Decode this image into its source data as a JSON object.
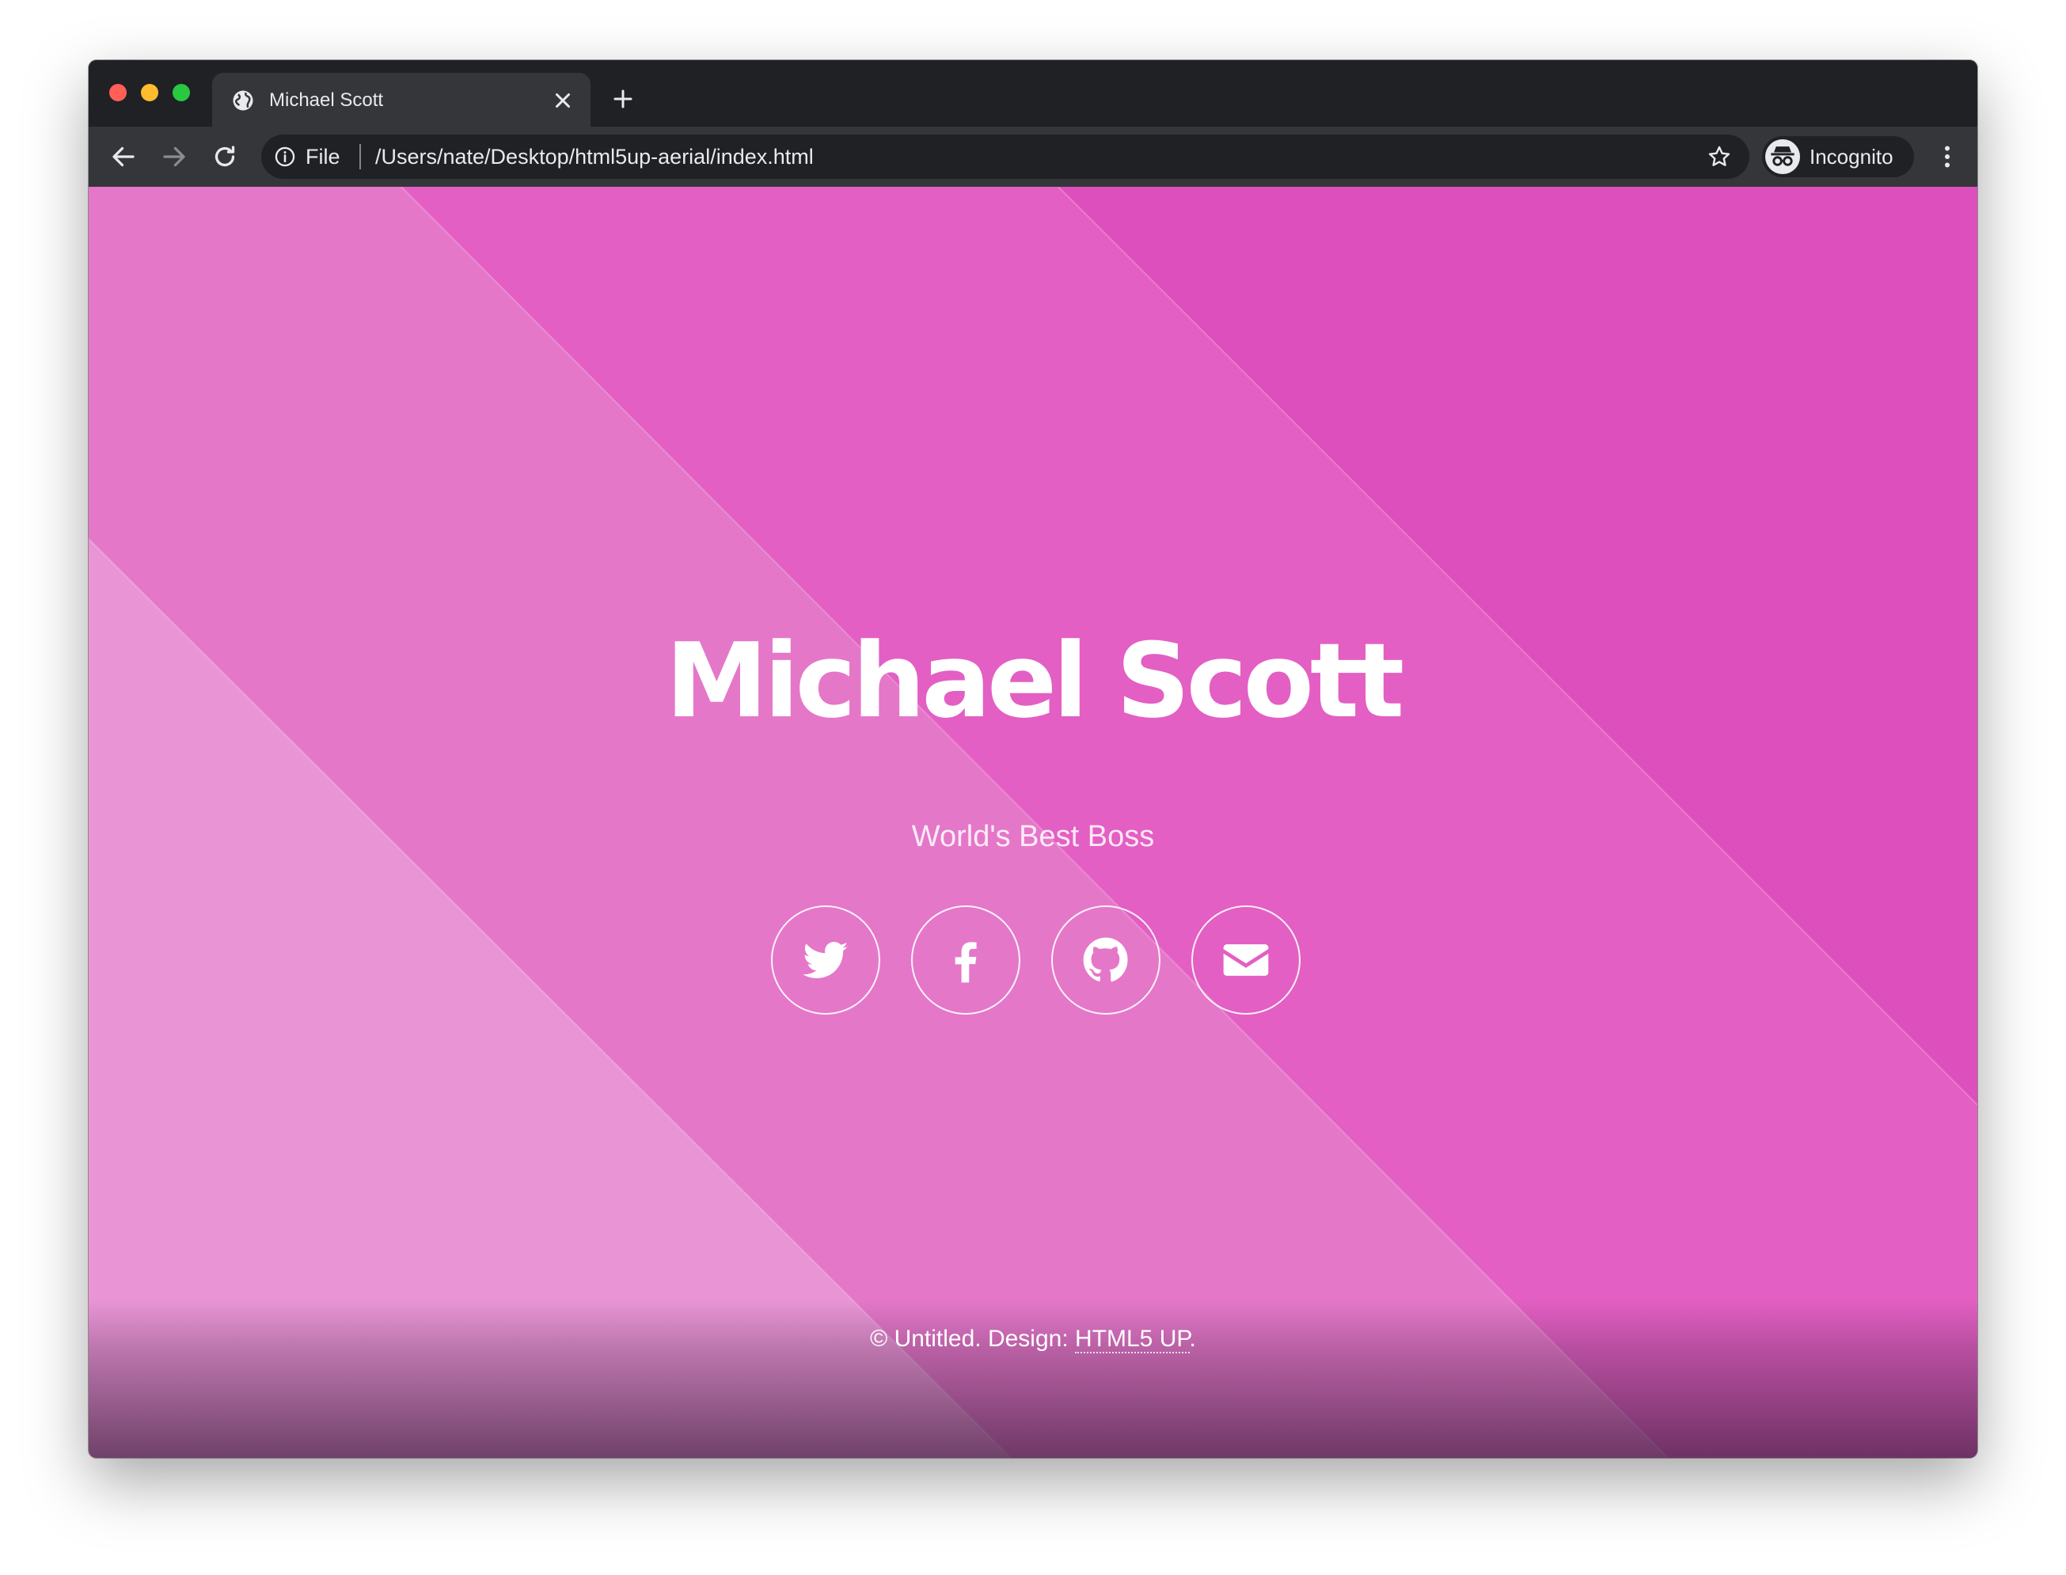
{
  "browser": {
    "tab_title": "Michael Scott",
    "file_label": "File",
    "url": "/Users/nate/Desktop/html5up-aerial/index.html",
    "profile_label": "Incognito"
  },
  "page": {
    "title": "Michael Scott",
    "subtitle": "World's Best Boss",
    "social_links": [
      {
        "icon": "twitter-icon"
      },
      {
        "icon": "facebook-icon"
      },
      {
        "icon": "github-icon"
      },
      {
        "icon": "email-icon"
      }
    ],
    "footer": {
      "text": "© Untitled. Design: ",
      "link": "HTML5 UP",
      "end": "."
    }
  },
  "colors": {
    "background": "#df52be",
    "window_frame": "#202124",
    "toolbar": "#35363a"
  }
}
